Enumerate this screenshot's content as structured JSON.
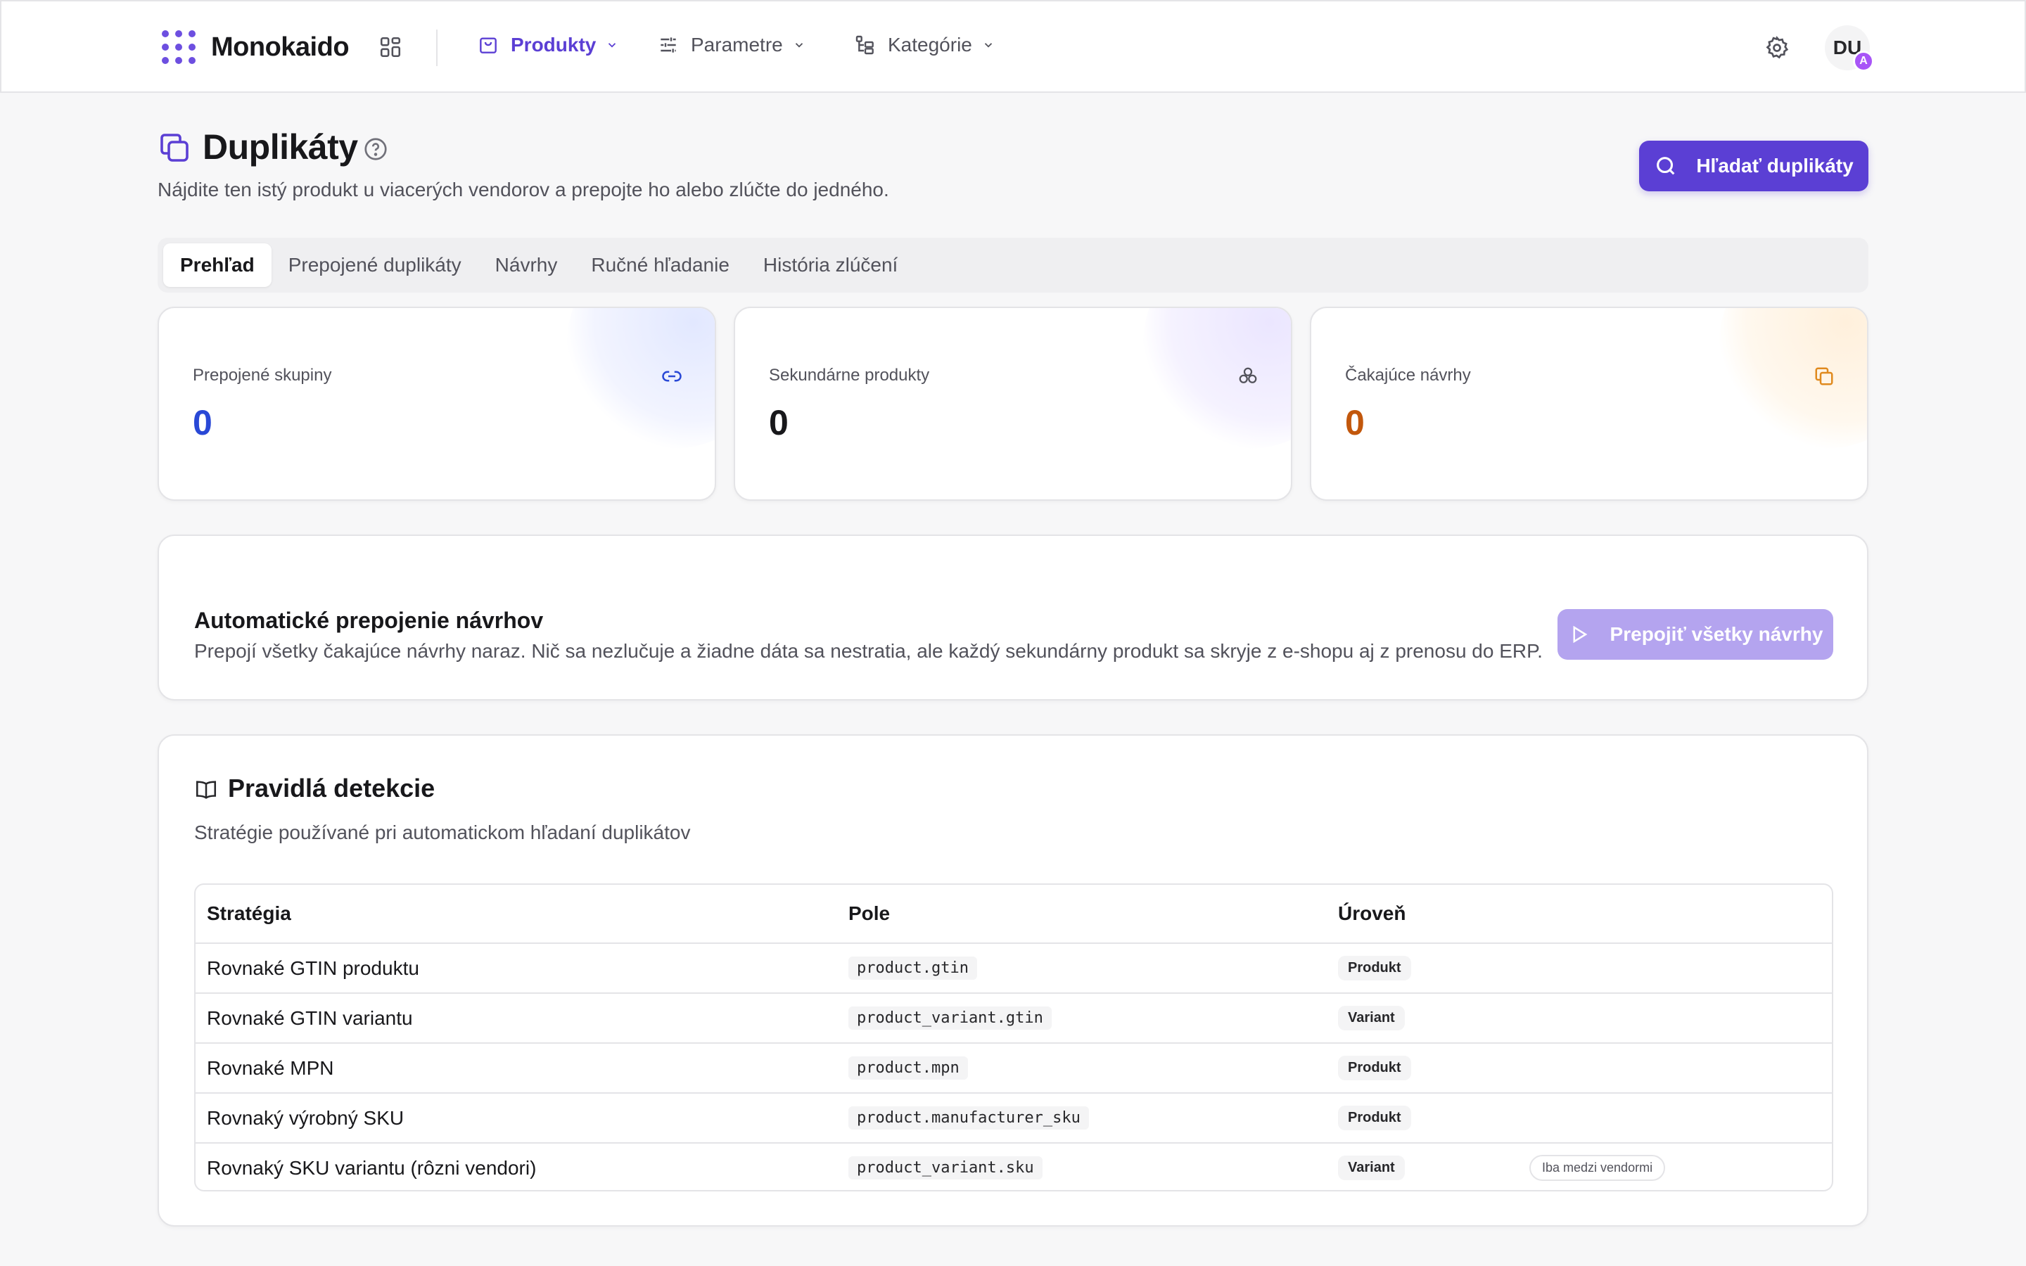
{
  "app": {
    "brand": "Monokaido",
    "nav": [
      {
        "label": "Produkty",
        "icon": "shopping-bag-icon",
        "active": true
      },
      {
        "label": "Parametre",
        "icon": "sliders-icon",
        "active": false
      },
      {
        "label": "Kategórie",
        "icon": "tree-icon",
        "active": false
      }
    ],
    "user": {
      "initials": "DU",
      "badge": "A"
    }
  },
  "page": {
    "title": "Duplikáty",
    "subtitle": "Nájdite ten istý produkt u viacerých vendorov a prepojte ho alebo zlúčte do jedného.",
    "search_button": "Hľadať duplikáty"
  },
  "tabs": [
    "Prehľad",
    "Prepojené duplikáty",
    "Návrhy",
    "Ručné hľadanie",
    "História zlúčení"
  ],
  "active_tab": "Prehľad",
  "stats": [
    {
      "label": "Prepojené skupiny",
      "value": "0",
      "icon": "link-icon",
      "color": "#2948d6"
    },
    {
      "label": "Sekundárne produkty",
      "value": "0",
      "icon": "cluster-icon",
      "color": "#18181b"
    },
    {
      "label": "Čakajúce návrhy",
      "value": "0",
      "icon": "copy-icon",
      "color": "#c2570c"
    }
  ],
  "auto_link": {
    "title": "Automatické prepojenie návrhov",
    "description": "Prepojí všetky čakajúce návrhy naraz. Nič sa nezlučuje a žiadne dáta sa nestratia, ale každý sekundárny produkt sa skryje z e-shopu aj z prenosu do ERP.",
    "button": "Prepojiť všetky návrhy"
  },
  "rules": {
    "title": "Pravidlá detekcie",
    "description": "Stratégie používané pri automatickom hľadaní duplikátov",
    "columns": [
      "Stratégia",
      "Pole",
      "Úroveň"
    ],
    "rows": [
      {
        "strategy": "Rovnaké GTIN produktu",
        "field": "product.gtin",
        "level": "Produkt",
        "note": ""
      },
      {
        "strategy": "Rovnaké GTIN variantu",
        "field": "product_variant.gtin",
        "level": "Variant",
        "note": ""
      },
      {
        "strategy": "Rovnaké MPN",
        "field": "product.mpn",
        "level": "Produkt",
        "note": ""
      },
      {
        "strategy": "Rovnaký výrobný SKU",
        "field": "product.manufacturer_sku",
        "level": "Produkt",
        "note": ""
      },
      {
        "strategy": "Rovnaký SKU variantu (rôzni vendori)",
        "field": "product_variant.sku",
        "level": "Variant",
        "note": "Iba medzi vendormi"
      }
    ]
  },
  "colors": {
    "accent": "#5b3fd4",
    "accent_disabled": "#b4a4ef",
    "brand_dots": "#6d4fe0"
  }
}
